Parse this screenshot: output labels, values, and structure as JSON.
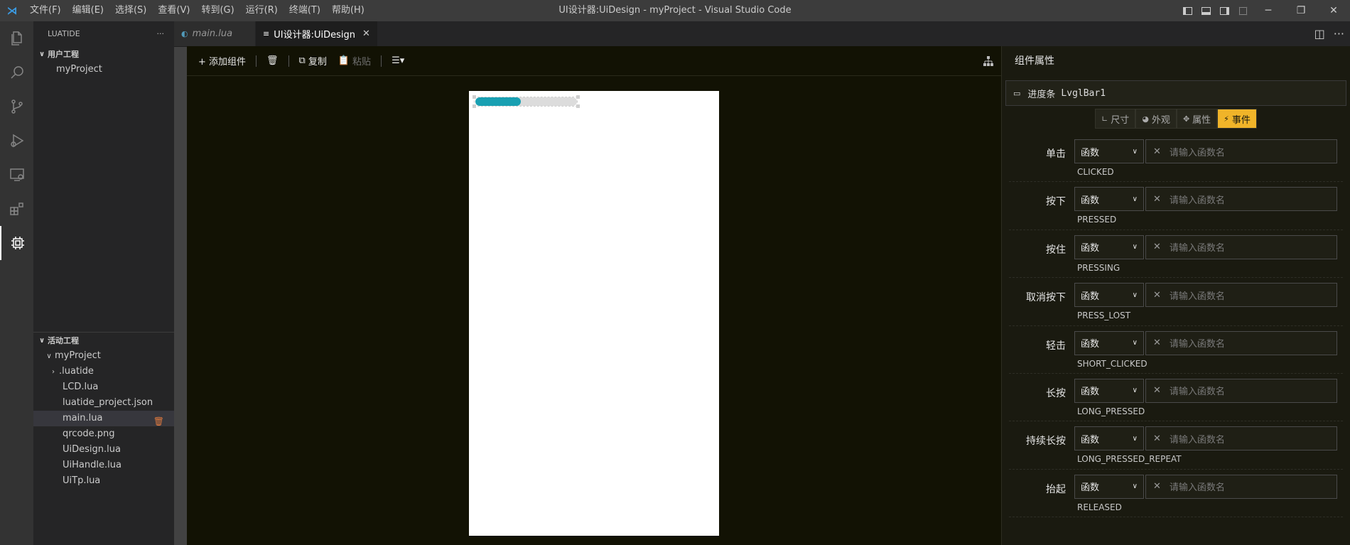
{
  "titlebar": {
    "menu": [
      "文件(F)",
      "编辑(E)",
      "选择(S)",
      "查看(V)",
      "转到(G)",
      "运行(R)",
      "终端(T)",
      "帮助(H)"
    ],
    "title": "UI设计器:UiDesign - myProject - Visual Studio Code"
  },
  "sidebar": {
    "title": "LUATIDE",
    "user_section": {
      "label": "用户工程",
      "items": [
        "myProject"
      ]
    },
    "active_section": {
      "label": "活动工程",
      "project": "myProject",
      "folder": ".luatide",
      "files": [
        "LCD.lua",
        "luatide_project.json",
        "main.lua",
        "qrcode.png",
        "UiDesign.lua",
        "UiHandle.lua",
        "UiTp.lua"
      ],
      "selected": "main.lua"
    }
  },
  "tabs": [
    {
      "label": "main.lua",
      "active": false
    },
    {
      "label": "UI设计器:UiDesign",
      "active": true
    }
  ],
  "toolbar": {
    "add": "+ 添加组件",
    "copy": "复制",
    "paste": "粘贴"
  },
  "canvas": {
    "progress_bar_value": 0.45,
    "fill_color": "#19a0b2"
  },
  "props": {
    "title": "组件属性",
    "component_type": "进度条",
    "component_name": "LvglBar1",
    "tabs": [
      "尺寸",
      "外观",
      "属性",
      "事件"
    ],
    "active_tab": "事件",
    "events": [
      {
        "label": "单击",
        "code": "CLICKED",
        "type": "函数",
        "placeholder": "请输入函数名"
      },
      {
        "label": "按下",
        "code": "PRESSED",
        "type": "函数",
        "placeholder": "请输入函数名"
      },
      {
        "label": "按住",
        "code": "PRESSING",
        "type": "函数",
        "placeholder": "请输入函数名"
      },
      {
        "label": "取消按下",
        "code": "PRESS_LOST",
        "type": "函数",
        "placeholder": "请输入函数名"
      },
      {
        "label": "轻击",
        "code": "SHORT_CLICKED",
        "type": "函数",
        "placeholder": "请输入函数名"
      },
      {
        "label": "长按",
        "code": "LONG_PRESSED",
        "type": "函数",
        "placeholder": "请输入函数名"
      },
      {
        "label": "持续长按",
        "code": "LONG_PRESSED_REPEAT",
        "type": "函数",
        "placeholder": "请输入函数名"
      },
      {
        "label": "抬起",
        "code": "RELEASED",
        "type": "函数",
        "placeholder": "请输入函数名"
      }
    ]
  }
}
